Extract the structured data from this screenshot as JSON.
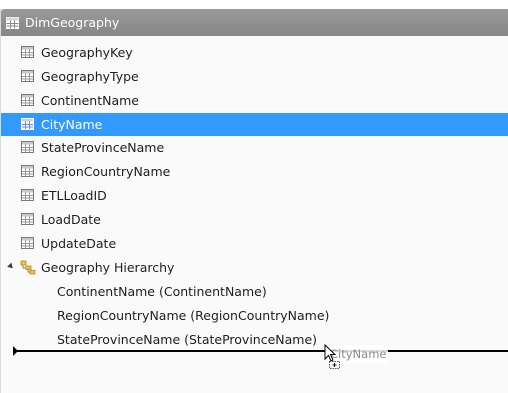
{
  "table": {
    "name": "DimGeography",
    "columns": [
      "GeographyKey",
      "GeographyType",
      "ContinentName",
      "CityName",
      "StateProvinceName",
      "RegionCountryName",
      "ETLLoadID",
      "LoadDate",
      "UpdateDate"
    ],
    "selected_column": "CityName"
  },
  "hierarchy": {
    "name": "Geography Hierarchy",
    "expanded": true,
    "levels": [
      "ContinentName (ContinentName)",
      "RegionCountryName (RegionCountryName)",
      "StateProvinceName (StateProvinceName)"
    ]
  },
  "drag": {
    "ghost_label": "CityName"
  },
  "colors": {
    "header": "#8f8f8f",
    "selection": "#3399ff",
    "drop_line": "#000000"
  },
  "icons": {
    "table": "table-icon",
    "column": "column-icon",
    "hierarchy": "hierarchy-icon",
    "expander": "expanded-triangle-icon",
    "cursor": "drag-copy-cursor-icon"
  }
}
